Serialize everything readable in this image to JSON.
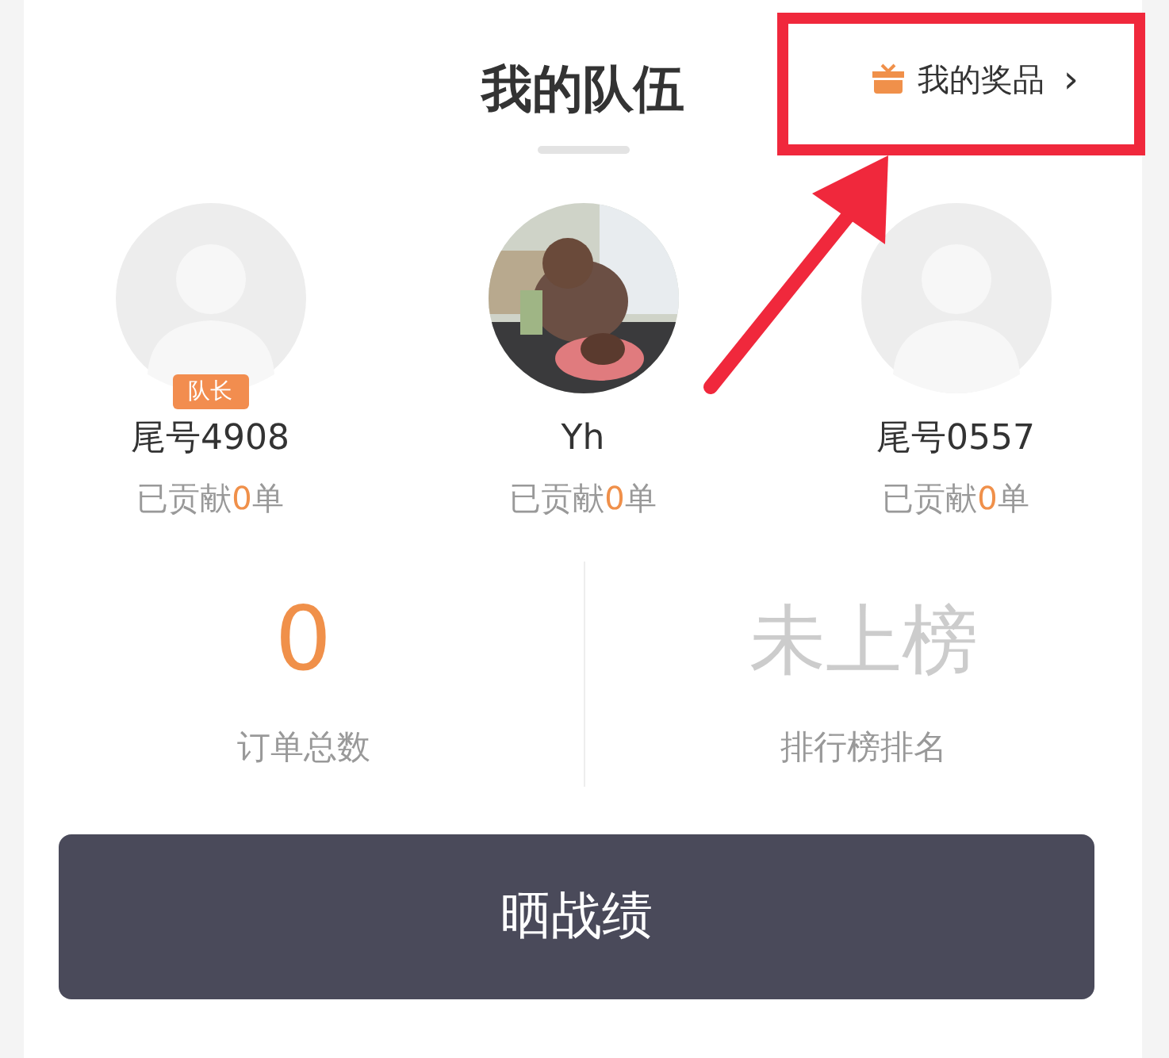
{
  "header": {
    "title": "我的队伍",
    "prize_link": {
      "label": "我的奖品",
      "chevron": "›"
    }
  },
  "members": [
    {
      "kind": "placeholder",
      "badge": "队长",
      "name": "尾号4908",
      "contribution": {
        "prefix": "已贡献",
        "count": "0",
        "suffix": "单"
      }
    },
    {
      "kind": "picture",
      "name": "Yh",
      "contribution": {
        "prefix": "已贡献",
        "count": "0",
        "suffix": "单"
      }
    },
    {
      "kind": "placeholder",
      "name": "尾号0557",
      "contribution": {
        "prefix": "已贡献",
        "count": "0",
        "suffix": "单"
      }
    }
  ],
  "stats": [
    {
      "kind": "number",
      "value": "0",
      "label": "订单总数"
    },
    {
      "kind": "status",
      "value": "未上榜",
      "label": "排行榜排名"
    }
  ],
  "share_button": {
    "label": "晒战绩"
  }
}
